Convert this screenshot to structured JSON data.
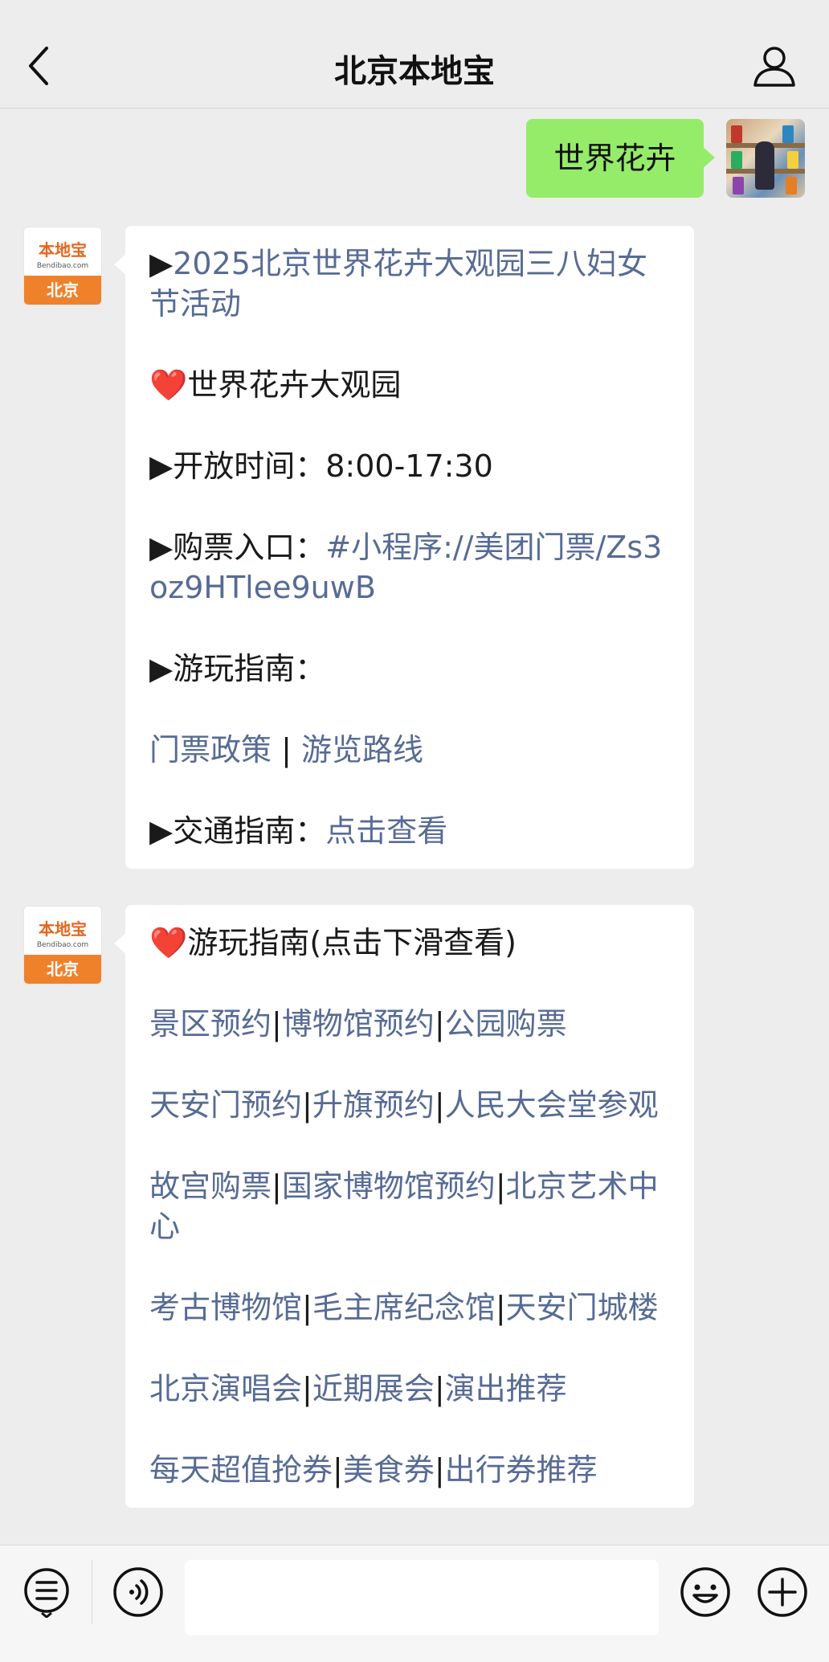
{
  "header": {
    "title": "北京本地宝"
  },
  "sent_message": {
    "text": "世界花卉"
  },
  "bot": {
    "avatar_top": "本地宝",
    "avatar_sub": "Bendibao.com",
    "avatar_bottom": "北京"
  },
  "message1": {
    "line1_marker": "▶",
    "line1_link": "2025北京世界花卉大观园三八妇女节活动",
    "line2_heart": "❤️",
    "line2_text": "世界花卉大观园",
    "hours_label": "▶开放时间：",
    "hours_value": "8:00-17:30",
    "ticket_label": "▶购票入口：",
    "ticket_link": "#小程序://美团门票/Zs3oz9HTlee9uwB",
    "guide_label": "▶游玩指南：",
    "guide_link1": "门票政策",
    "guide_sep": " | ",
    "guide_link2": "游览路线",
    "traffic_label": "▶交通指南：",
    "traffic_link": "点击查看"
  },
  "message2": {
    "heading_heart": "❤️",
    "heading_text": "游玩指南(点击下滑查看)",
    "sep": "|",
    "rows": [
      [
        "景区预约",
        "博物馆预约",
        "公园购票"
      ],
      [
        "天安门预约",
        "升旗预约",
        "人民大会堂参观"
      ],
      [
        "故宫购票",
        "国家博物馆预约",
        "北京艺术中心"
      ],
      [
        "考古博物馆",
        "毛主席纪念馆",
        "天安门城楼"
      ],
      [
        "北京演唱会",
        "近期展会",
        "演出推荐"
      ],
      [
        "每天超值抢券",
        "美食券",
        "出行券推荐"
      ]
    ]
  }
}
